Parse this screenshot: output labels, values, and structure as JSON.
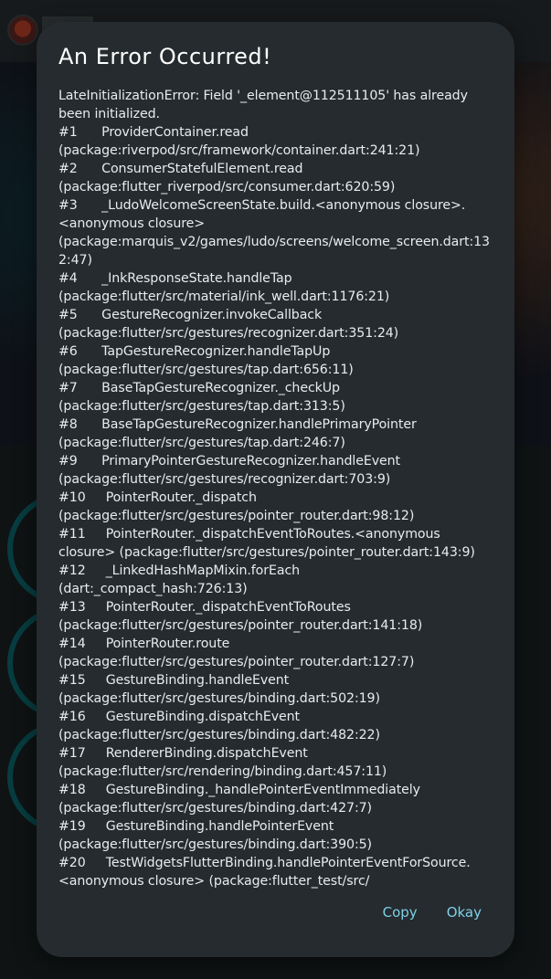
{
  "dialog": {
    "title": "An Error Occurred!",
    "message": "LateInitializationError: Field '_element@112511105' has already been initialized.\n#1      ProviderContainer.read (package:riverpod/src/framework/container.dart:241:21)\n#2      ConsumerStatefulElement.read (package:flutter_riverpod/src/consumer.dart:620:59)\n#3      _LudoWelcomeScreenState.build.<anonymous closure>.<anonymous closure> (package:marquis_v2/games/ludo/screens/welcome_screen.dart:132:47)\n#4      _InkResponseState.handleTap (package:flutter/src/material/ink_well.dart:1176:21)\n#5      GestureRecognizer.invokeCallback (package:flutter/src/gestures/recognizer.dart:351:24)\n#6      TapGestureRecognizer.handleTapUp (package:flutter/src/gestures/tap.dart:656:11)\n#7      BaseTapGestureRecognizer._checkUp (package:flutter/src/gestures/tap.dart:313:5)\n#8      BaseTapGestureRecognizer.handlePrimaryPointer (package:flutter/src/gestures/tap.dart:246:7)\n#9      PrimaryPointerGestureRecognizer.handleEvent (package:flutter/src/gestures/recognizer.dart:703:9)\n#10     PointerRouter._dispatch (package:flutter/src/gestures/pointer_router.dart:98:12)\n#11     PointerRouter._dispatchEventToRoutes.<anonymous closure> (package:flutter/src/gestures/pointer_router.dart:143:9)\n#12     _LinkedHashMapMixin.forEach (dart:_compact_hash:726:13)\n#13     PointerRouter._dispatchEventToRoutes (package:flutter/src/gestures/pointer_router.dart:141:18)\n#14     PointerRouter.route (package:flutter/src/gestures/pointer_router.dart:127:7)\n#15     GestureBinding.handleEvent (package:flutter/src/gestures/binding.dart:502:19)\n#16     GestureBinding.dispatchEvent (package:flutter/src/gestures/binding.dart:482:22)\n#17     RendererBinding.dispatchEvent (package:flutter/src/rendering/binding.dart:457:11)\n#18     GestureBinding._handlePointerEventImmediately (package:flutter/src/gestures/binding.dart:427:7)\n#19     GestureBinding.handlePointerEvent (package:flutter/src/gestures/binding.dart:390:5)\n#20     TestWidgetsFlutterBinding.handlePointerEventForSource.<anonymous closure> (package:flutter_test/src/",
    "copy_label": "Copy",
    "okay_label": "Okay"
  },
  "colors": {
    "dialog_bg": "#252b2e",
    "title": "#ffffff",
    "text": "#e8ecee",
    "button_text": "#7fd0e6"
  }
}
